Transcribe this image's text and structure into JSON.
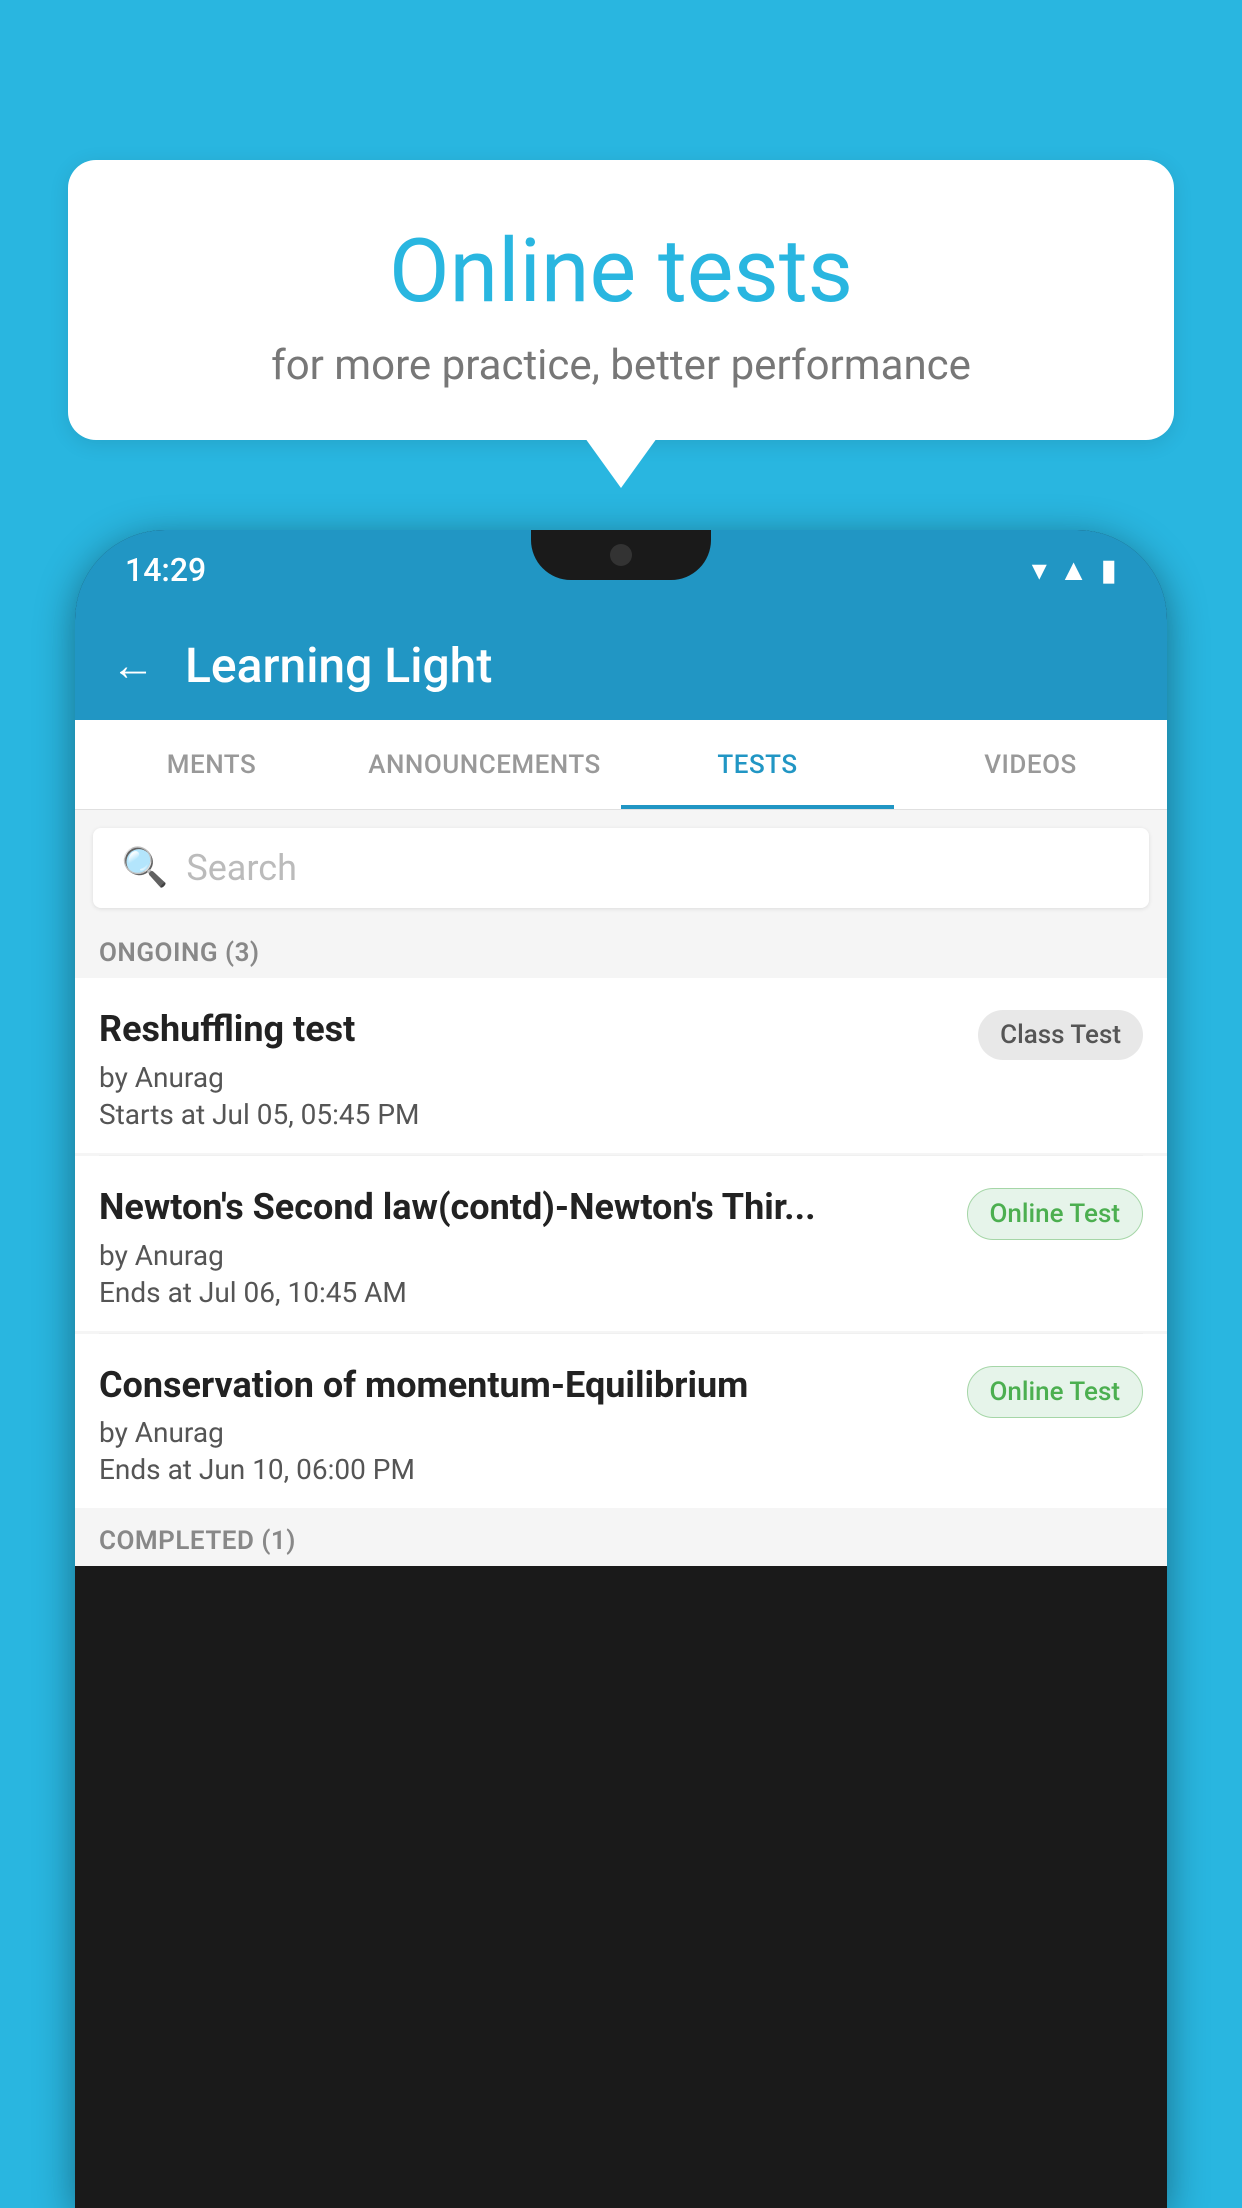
{
  "background": {
    "color": "#29b6e0"
  },
  "bubble": {
    "title": "Online tests",
    "subtitle": "for more practice, better performance"
  },
  "phone": {
    "status_bar": {
      "time": "14:29",
      "icons": [
        "wifi",
        "signal",
        "battery"
      ]
    },
    "app_bar": {
      "back_label": "←",
      "title": "Learning Light"
    },
    "tabs": [
      {
        "label": "MENTS",
        "active": false
      },
      {
        "label": "ANNOUNCEMENTS",
        "active": false
      },
      {
        "label": "TESTS",
        "active": true
      },
      {
        "label": "VIDEOS",
        "active": false
      }
    ],
    "search": {
      "placeholder": "Search"
    },
    "sections": [
      {
        "header": "ONGOING (3)",
        "items": [
          {
            "name": "Reshuffling test",
            "by": "by Anurag",
            "time": "Starts at  Jul 05, 05:45 PM",
            "badge": "Class Test",
            "badge_type": "class"
          },
          {
            "name": "Newton's Second law(contd)-Newton's Thir...",
            "by": "by Anurag",
            "time": "Ends at  Jul 06, 10:45 AM",
            "badge": "Online Test",
            "badge_type": "online"
          },
          {
            "name": "Conservation of momentum-Equilibrium",
            "by": "by Anurag",
            "time": "Ends at  Jun 10, 06:00 PM",
            "badge": "Online Test",
            "badge_type": "online"
          }
        ]
      },
      {
        "header": "COMPLETED (1)",
        "items": []
      }
    ]
  }
}
